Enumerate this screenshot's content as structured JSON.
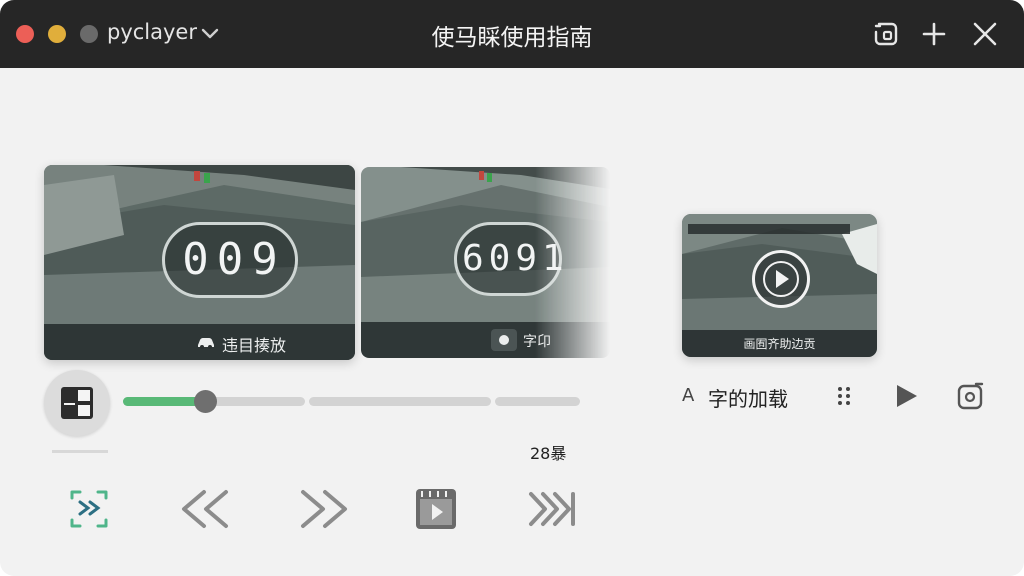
{
  "titlebar": {
    "app_name": "pyclayer",
    "title": "使马睬使用指南"
  },
  "cards": [
    {
      "counter": "009",
      "caption": "违目揍放"
    },
    {
      "counter": "6091",
      "caption": "字卬"
    },
    {
      "caption": "画囿齐助边贡"
    }
  ],
  "progress": {
    "fraction": 0.18,
    "time_label": "28暴"
  },
  "controls": [
    "shuffle-icon",
    "rewind-icon",
    "fast-forward-icon",
    "video-clip-icon",
    "skip-forward-icon"
  ],
  "right_panel": {
    "prefix": "A",
    "label": "字的加载"
  },
  "colors": {
    "titlebar": "#262626",
    "accent_green": "#59b977",
    "background": "#f2f2f2"
  }
}
